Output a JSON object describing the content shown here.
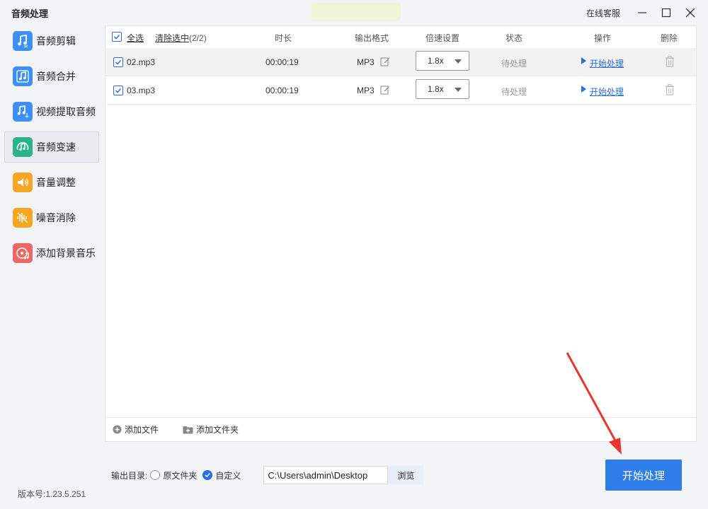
{
  "app": {
    "title": "音频处理",
    "support": "在线客服"
  },
  "sidebar": {
    "items": [
      {
        "label": "音频剪辑",
        "icon": "music-scissors-icon",
        "color": "#3d8ff5"
      },
      {
        "label": "音频合并",
        "icon": "music-merge-icon",
        "color": "#3d8ff5"
      },
      {
        "label": "视频提取音频",
        "icon": "music-extract-icon",
        "color": "#3d8ff5"
      },
      {
        "label": "音频变速",
        "icon": "music-speed-icon",
        "color": "#2bb38a"
      },
      {
        "label": "音量调整",
        "icon": "speaker-icon",
        "color": "#f5a623"
      },
      {
        "label": "噪音消除",
        "icon": "noise-icon",
        "color": "#f5a623"
      },
      {
        "label": "添加背景音乐",
        "icon": "disc-music-icon",
        "color": "#ec6767"
      }
    ],
    "active_index": 3
  },
  "table": {
    "select_all": "全选",
    "clear_selected": "清除选中",
    "count": "(2/2)",
    "headers": {
      "duration": "时长",
      "format": "输出格式",
      "speed": "倍速设置",
      "status": "状态",
      "action": "操作",
      "delete": "删除"
    },
    "rows": [
      {
        "name": "02.mp3",
        "duration": "00:00:19",
        "format": "MP3",
        "speed": "1.8x",
        "status": "待处理",
        "action": "开始处理"
      },
      {
        "name": "03.mp3",
        "duration": "00:00:19",
        "format": "MP3",
        "speed": "1.8x",
        "status": "待处理",
        "action": "开始处理"
      }
    ]
  },
  "footer": {
    "add_file": "添加文件",
    "add_folder": "添加文件夹"
  },
  "output": {
    "label": "输出目录:",
    "option_original": "原文件夹",
    "option_custom": "自定义",
    "path": "C:\\Users\\admin\\Desktop",
    "browse": "浏览"
  },
  "start_button": "开始处理",
  "version": "版本号:1.23.5.251",
  "colors": {
    "accent": "#2f7de8",
    "link": "#2b6de5",
    "arrow": "#e8362c"
  }
}
